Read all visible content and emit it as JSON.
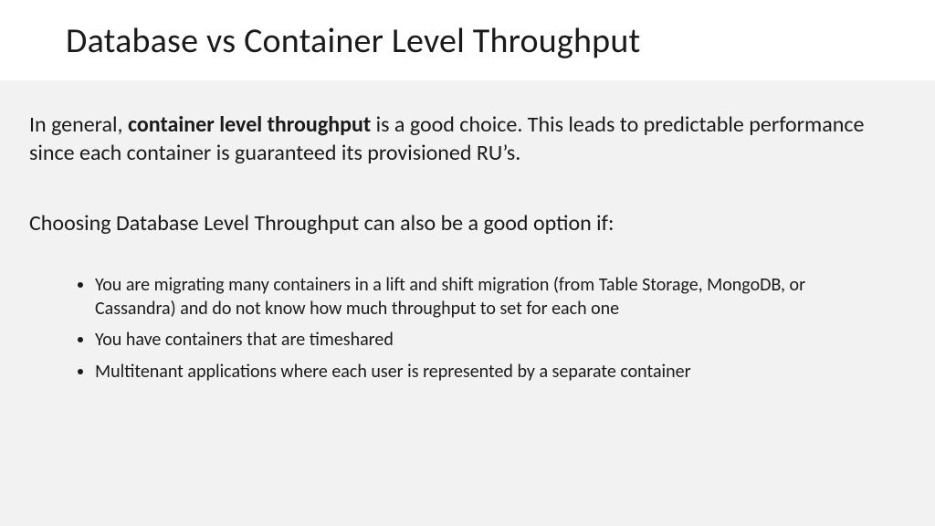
{
  "header": {
    "title": "Database vs Container Level Throughput"
  },
  "body": {
    "p1_pre": "In general, ",
    "p1_bold": "container level throughput",
    "p1_post": " is a good choice. This leads to predictable performance since each container is guaranteed its provisioned RU’s.",
    "p2": "Choosing Database Level Throughput can also be a good option if:",
    "bullets": [
      "You are migrating many containers in a lift and shift migration (from Table Storage, MongoDB, or Cassandra) and do not know how much throughput to set for each one",
      "You have containers that are timeshared",
      "Multitenant applications where each user is represented by a separate container"
    ]
  }
}
